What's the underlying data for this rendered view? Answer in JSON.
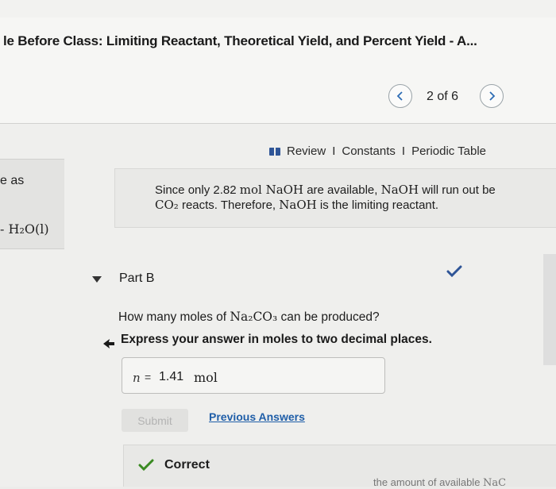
{
  "header": {
    "title": "le Before Class: Limiting Reactant, Theoretical Yield, and Percent Yield - A...",
    "pagination": {
      "current": 2,
      "total": 6,
      "label": "2 of 6"
    },
    "prev_icon": "chevron-left-icon",
    "next_icon": "chevron-right-icon"
  },
  "review_links": {
    "review": "Review",
    "separator1": "I",
    "constants": "Constants",
    "separator2": "I",
    "periodic_table": "Periodic Table",
    "icon": "book-icon"
  },
  "left_panel": {
    "line1": "e as",
    "line2": "- H₂O(l)"
  },
  "previous_answer": {
    "line1_a": "Since only 2.82 ",
    "line1_b": "mol NaOH",
    "line1_c": " are available, ",
    "line1_d": "NaOH",
    "line1_e": " will run out be",
    "line2_a": "CO₂",
    "line2_b": " reacts. Therefore, ",
    "line2_c": "NaOH",
    "line2_d": " is the limiting reactant."
  },
  "part": {
    "label": "Part B",
    "status_icon": "checkmark-icon",
    "accent": "#2f5597"
  },
  "question": {
    "text_a": "How many moles of ",
    "formula": "Na₂CO₃",
    "text_b": " can be produced?",
    "instruction": "Express your answer in moles to two decimal places."
  },
  "answer_input": {
    "variable": "n",
    "equals": "=",
    "value": "1.41",
    "unit": "mol"
  },
  "actions": {
    "submit_label": "Submit",
    "previous_answers_label": "Previous Answers",
    "link_color": "#1f5ea8"
  },
  "feedback": {
    "label": "Correct",
    "check_color": "#3a8a22",
    "cutoff_a": "the amount of available ",
    "cutoff_b": "NaC"
  }
}
